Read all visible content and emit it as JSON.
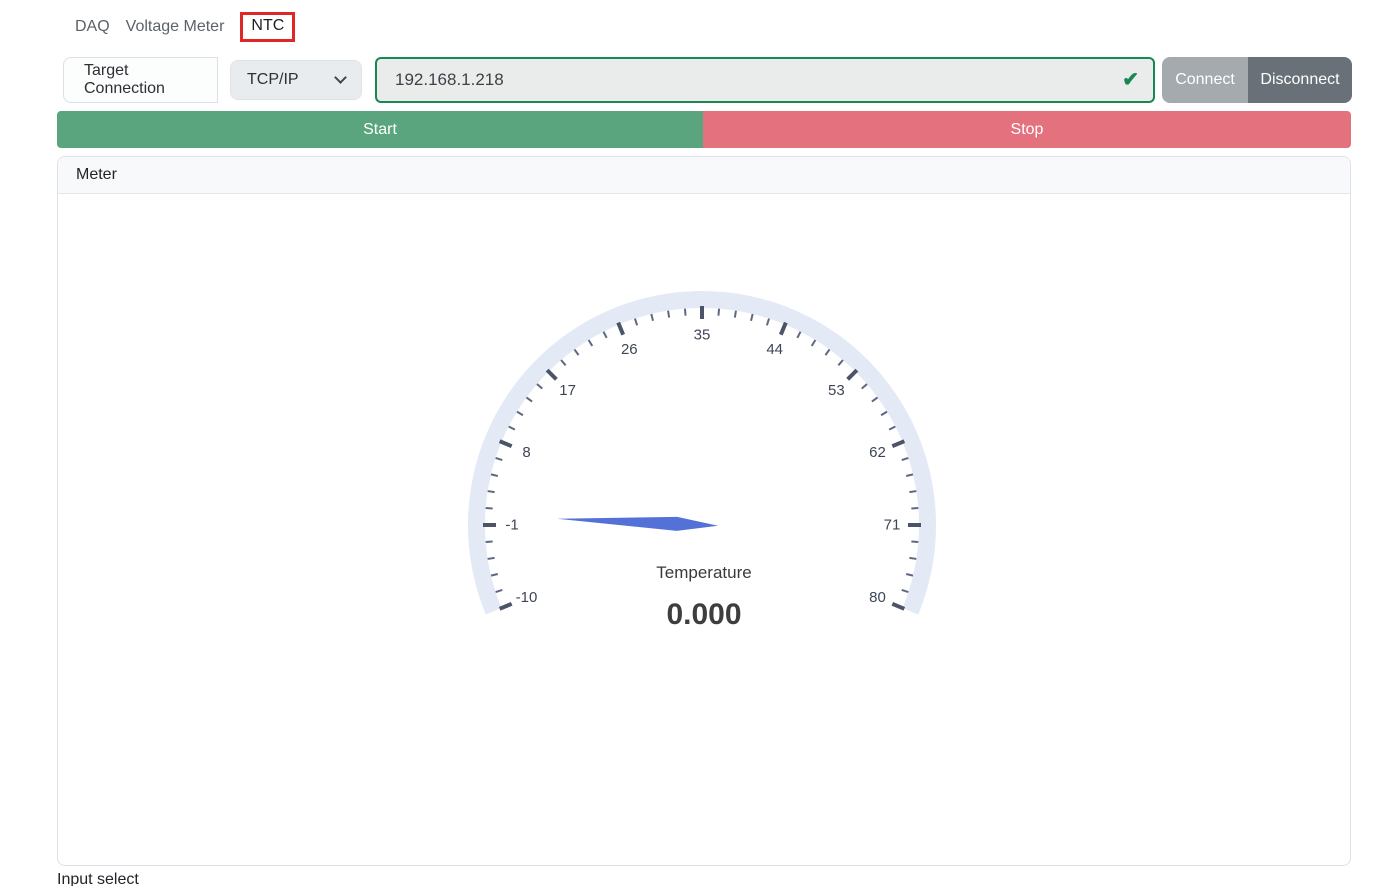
{
  "tabs": [
    {
      "label": "DAQ"
    },
    {
      "label": "Voltage Meter"
    },
    {
      "label": "NTC",
      "highlighted": true
    }
  ],
  "connection": {
    "group_label": "Target Connection",
    "protocol": "TCP/IP",
    "address": "192.168.1.218",
    "check_icon": "✔",
    "connect_label": "Connect",
    "disconnect_label": "Disconnect"
  },
  "controls": {
    "start_label": "Start",
    "stop_label": "Stop"
  },
  "panel": {
    "title": "Meter"
  },
  "footer": {
    "label": "Input select"
  },
  "colors": {
    "start_green": "#5aa57e",
    "stop_red": "#e4717e",
    "connect_gray": "#a5aaaf",
    "disconnect_gray": "#697077",
    "valid_green": "#198754",
    "highlight_red": "#e12626",
    "gauge_arc": "#e4e9f6",
    "tick_major": "#4b5468",
    "tick_minor": "#5e6880",
    "tick_label": "#3e4656",
    "needle": "#5471d8",
    "gauge_text": "#3a3a3a",
    "gauge_value": "#3e3e3e"
  },
  "chart_data": {
    "type": "gauge",
    "title": "Temperature",
    "min": -10,
    "max": 80,
    "major_tick_step": 9,
    "minor_tick_step": 1.8,
    "major_tick_labels": [
      -10,
      -1,
      8,
      17,
      26,
      35,
      44,
      53,
      62,
      71,
      80
    ],
    "value": 0,
    "value_display": "0.000",
    "start_angle_deg": 202.5,
    "sweep_deg": 225
  }
}
